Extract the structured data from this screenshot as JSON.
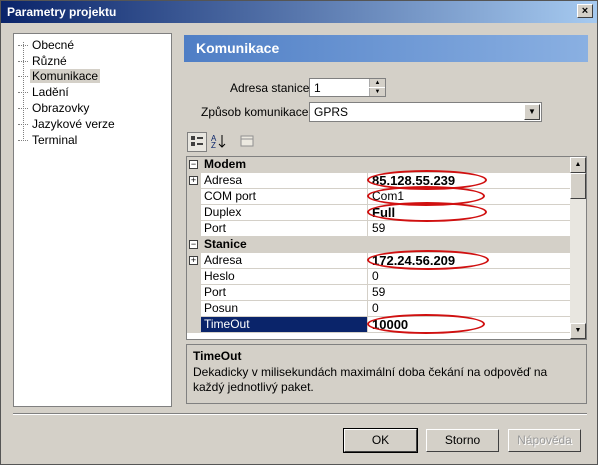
{
  "window": {
    "title": "Parametry projektu",
    "close_glyph": "×"
  },
  "tree": {
    "items": [
      {
        "label": "Obecné"
      },
      {
        "label": "Různé"
      },
      {
        "label": "Komunikace",
        "selected": true
      },
      {
        "label": "Ladění"
      },
      {
        "label": "Obrazovky"
      },
      {
        "label": "Jazykové verze"
      },
      {
        "label": "Terminal"
      }
    ]
  },
  "section": {
    "title": "Komunikace"
  },
  "form": {
    "station_label": "Adresa stanice:",
    "station_value": "1",
    "comm_label": "Způsob komunikace",
    "comm_value": "GPRS"
  },
  "toolbar": {
    "categorized_icon": "categorized-icon",
    "alphabetical_icon": "alphabetical-icon",
    "property_pages_icon": "property-pages-icon"
  },
  "grid": {
    "rows": [
      {
        "type": "cat",
        "name": "Modem",
        "expander": "−"
      },
      {
        "type": "prop",
        "name": "Adresa",
        "value": "85.128.55.239",
        "expander": "+",
        "big": true
      },
      {
        "type": "prop",
        "name": "COM port",
        "value": "Com1"
      },
      {
        "type": "prop",
        "name": "Duplex",
        "value": "Full",
        "big": true
      },
      {
        "type": "prop",
        "name": "Port",
        "value": "59"
      },
      {
        "type": "cat",
        "name": "Stanice",
        "expander": "−"
      },
      {
        "type": "prop",
        "name": "Adresa",
        "value": "172.24.56.209",
        "expander": "+",
        "big": true
      },
      {
        "type": "prop",
        "name": "Heslo",
        "value": "0"
      },
      {
        "type": "prop",
        "name": "Port",
        "value": "59"
      },
      {
        "type": "prop",
        "name": "Posun",
        "value": "0"
      },
      {
        "type": "prop",
        "name": "TimeOut",
        "value": "10000",
        "selected": true,
        "big": true
      }
    ]
  },
  "help": {
    "title": "TimeOut",
    "description": "Dekadicky v milisekundách maximální doba čekání na odpověď na každý jednotlivý paket."
  },
  "buttons": {
    "ok": "OK",
    "cancel": "Storno",
    "help": "Nápověda"
  },
  "colors": {
    "annotation": "#d01010",
    "selection": "#0a246a",
    "header": "#4f7ec5"
  }
}
